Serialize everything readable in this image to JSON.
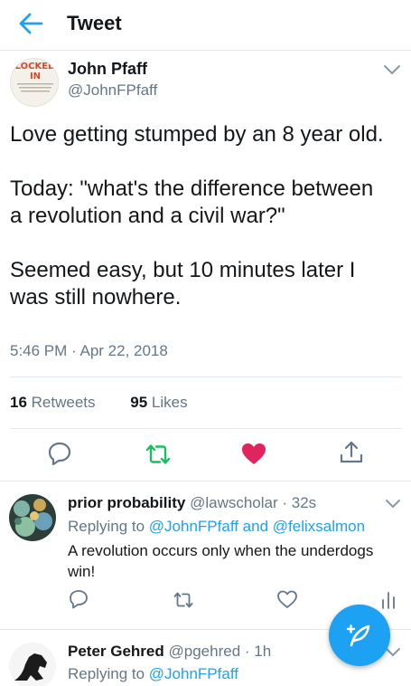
{
  "header": {
    "title": "Tweet"
  },
  "tweet": {
    "author_name": "John Pfaff",
    "author_handle": "@JohnFPfaff",
    "avatar_text": {
      "line1": "LOCKED",
      "line2": "IN"
    },
    "body": [
      "Love getting stumped by an 8 year old.",
      "Today: \"what's the difference between",
      "a revolution and a civil war?\"",
      "Seemed easy, but 10 minutes later I",
      "was still nowhere."
    ],
    "timestamp": "5:46 PM · Apr 22, 2018",
    "retweets_count": "16",
    "retweets_label": "Retweets",
    "likes_count": "95",
    "likes_label": "Likes",
    "liked": true
  },
  "replies": [
    {
      "name": "prior probability",
      "handle": "@lawscholar",
      "time": "· 32s",
      "replying_prefix": "Replying to",
      "replying_links": "@JohnFPfaff and @felixsalmon",
      "text": "A revolution occurs only when the underdogs win!"
    },
    {
      "name": "Peter Gehred",
      "handle": "@pgehred",
      "time": "· 1h",
      "replying_prefix": "Replying to",
      "replying_links": "@JohnFPfaff"
    }
  ],
  "icons": {
    "back": "arrow-left-icon",
    "reply": "speech-bubble-icon",
    "retweet": "retweet-icon",
    "like": "heart-icon",
    "share": "share-icon",
    "compose": "compose-feather-icon",
    "more": "chevron-down-icon"
  },
  "colors": {
    "accent": "#1da1f2",
    "retweet_green": "#17bf63",
    "like_red": "#e0245e",
    "muted": "#657786",
    "divider": "#e1e8ed"
  }
}
